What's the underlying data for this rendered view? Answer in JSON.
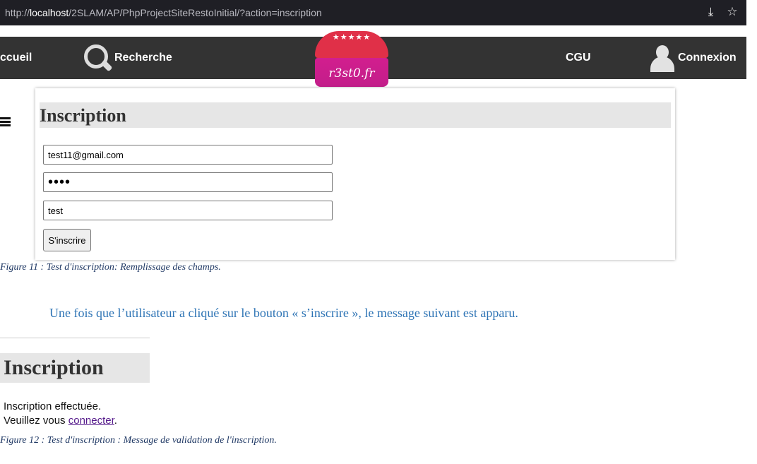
{
  "browser": {
    "url_prefix": "http://",
    "url_host": "localhost",
    "url_path": "/2SLAM/AP/PhpProjectSiteRestoInitial/?action=inscription",
    "download_icon": "download-icon",
    "bookmark_icon": "star-icon"
  },
  "nav": {
    "accueil": "ccueil",
    "recherche": "Recherche",
    "cgu": "CGU",
    "connexion": "Connexion"
  },
  "logo": {
    "stars": "★★★★★",
    "name": "r3st0.fr",
    "colors": {
      "top": "#e03048",
      "bottom": "#c21e8a"
    }
  },
  "form": {
    "title": "Inscription",
    "email_value": "test11@gmail.com",
    "password_value": "••••",
    "pseudo_value": "test",
    "submit_label": "S'inscrire"
  },
  "captions": {
    "figure11": "Figure 11 : Test d'inscription: Remplissage des champs.",
    "figure12": "Figure 12 : Test d'inscription : Message de validation de l'inscription."
  },
  "paragraph": "Une fois que l’utilisateur a cliqué sur le bouton « s’inscrire », le message suivant est apparu.",
  "result": {
    "title": "Inscription",
    "line1": "Inscription effectuée.",
    "line2_prefix": "Veuillez vous ",
    "link": "connecter",
    "line2_suffix": "."
  }
}
